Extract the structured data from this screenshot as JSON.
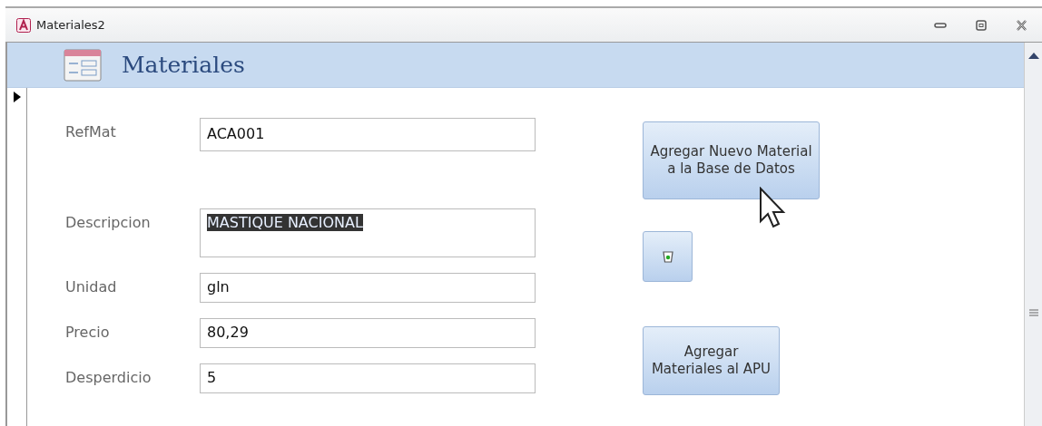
{
  "window": {
    "title": "Materiales2"
  },
  "header": {
    "title": "Materiales"
  },
  "record_selector": {
    "current": true
  },
  "fields": [
    {
      "label": "RefMat",
      "value": "ACA001",
      "kind": "single",
      "highlighted": false
    },
    {
      "label": "Descripcion",
      "value": "MASTIQUE NACIONAL",
      "kind": "multi",
      "highlighted": true
    },
    {
      "label": "Unidad",
      "value": "gln",
      "kind": "single",
      "highlighted": false
    },
    {
      "label": "Precio",
      "value": "80,29",
      "kind": "single",
      "highlighted": false
    },
    {
      "label": "Desperdicio",
      "value": "5",
      "kind": "single",
      "highlighted": false
    }
  ],
  "buttons": [
    {
      "label": "Agregar Nuevo Material a la Base de Datos",
      "kind": "text"
    },
    {
      "kind": "icon"
    },
    {
      "label": "Agregar Materiales al APU",
      "kind": "text"
    }
  ]
}
